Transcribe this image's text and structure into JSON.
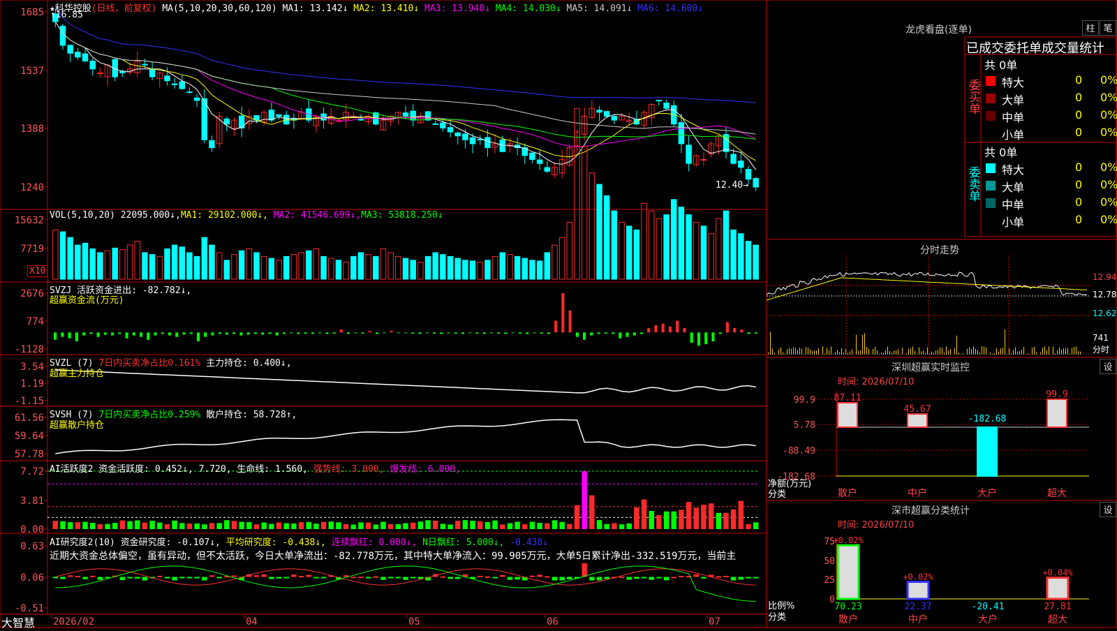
{
  "app": {
    "brand": "大智慧"
  },
  "main_chart": {
    "title_star": "★",
    "stock_name": "科华控股",
    "mode": "(日线，前复权)",
    "ma_params": "MA(5,10,20,30,60,120)",
    "ma_values": [
      {
        "label": "MA1: 13.142↓",
        "color": "#ffffff"
      },
      {
        "label": "MA2: 13.410↓",
        "color": "#ffff00"
      },
      {
        "label": "MA3: 13.940↓",
        "color": "#ff00ff"
      },
      {
        "label": "MA4: 14.030↓",
        "color": "#00ff00"
      },
      {
        "label": "MA5: 14.091↓",
        "color": "#cccccc"
      },
      {
        "label": "MA6: 14.600↓",
        "color": "#3333ff"
      }
    ],
    "high_label": "16.85",
    "low_label": "12.40",
    "y_ticks": [
      "1685",
      "1537",
      "1388",
      "1240"
    ]
  },
  "vol_panel": {
    "label": "VOL(5,10,20)",
    "value": "22095.000↓,",
    "ma1": "MA1: 29102.000↓,",
    "ma2": "MA2: 41546.699↓,",
    "ma3": "MA3: 53818.250↓",
    "y_ticks": [
      "15632",
      "7719"
    ],
    "multiplier": "X10"
  },
  "svzj_panel": {
    "label": "SVZJ  活跃资金进出: -82.782↓,",
    "sub": "超赢资金流(万元)",
    "y_ticks": [
      "2676",
      "774",
      "-1128"
    ]
  },
  "svzl_panel": {
    "label": "SVZL (7)",
    "label2": "7日内买卖净占比0.161%",
    "label3": "主力持仓: 0.400↓,",
    "sub": "超赢主力持仓",
    "y_ticks": [
      "3.54",
      "1.19",
      "-1.15"
    ]
  },
  "svsh_panel": {
    "label": "SVSH (7)",
    "label2": "7日内买卖净占比0.259%",
    "label3": "散户持仓: 58.728↑,",
    "sub": "超赢散户持仓",
    "y_ticks": [
      "61.56",
      "59.64",
      "57.78"
    ]
  },
  "ai_active_panel": {
    "label": "AI活跃度2 资金活跃度: 0.452↓, 7.720, 生命线: 1.560,",
    "label2": "强势线: 3.000,",
    "label3": "爆发线: 6.000,",
    "y_ticks": [
      "7.72",
      "3.81",
      "0.00"
    ]
  },
  "ai_research_panel": {
    "label": "AI研究度2(10) 资金研究度: -0.107↓,",
    "label2": "平均研究度: -0.438↓,",
    "label3": "连续飘红: 0.000↓,",
    "label4": "N日飘红: 5.000↓,",
    "label5": "-0.438↓",
    "commentary": "近期大资金总体偏空，虽有异动，但不太活跃，今日大单净流出：-82.778万元，其中特大单净流入：99.905万元，大单5日累计净出-332.519万元，当前主",
    "y_ticks": [
      "0.63",
      "0.06",
      "-0.51"
    ]
  },
  "x_axis": [
    "2026/02",
    "04",
    "05",
    "06",
    "07"
  ],
  "right": {
    "lhb_title": "龙虎看盘(逐单)",
    "btn_zhu": "柱",
    "btn_bi": "笔",
    "order_header": "已成交委托单成交量统计",
    "buy_side": {
      "side_label": "委买单",
      "total": "共 0单",
      "rows": [
        {
          "name": "特大",
          "count": "0",
          "pct": "0%",
          "color": "#ff0000"
        },
        {
          "name": "大单",
          "count": "0",
          "pct": "0%",
          "color": "#990000"
        },
        {
          "name": "中单",
          "count": "0",
          "pct": "0%",
          "color": "#660000"
        },
        {
          "name": "小单",
          "count": "0",
          "pct": "0%",
          "color": "#000000"
        }
      ]
    },
    "sell_side": {
      "side_label": "委卖单",
      "total": "共 0单",
      "rows": [
        {
          "name": "特大",
          "count": "0",
          "pct": "0%",
          "color": "#00ffff"
        },
        {
          "name": "大单",
          "count": "0",
          "pct": "0%",
          "color": "#009999"
        },
        {
          "name": "中单",
          "count": "0",
          "pct": "0%",
          "color": "#006666"
        },
        {
          "name": "小单",
          "count": "0",
          "pct": "0%",
          "color": "#000000"
        }
      ]
    },
    "intraday": {
      "title": "分时走势",
      "y_ticks": [
        "12.94",
        "12.78",
        "12.62"
      ],
      "vol_tick": "741",
      "vol_label": "分时"
    },
    "sz_monitor": {
      "title": "深圳超赢实时监控",
      "settings": "设",
      "time": "时间: 2026/07/10",
      "y_ticks": [
        "99.9",
        "5.78",
        "-88.49",
        "-182.68"
      ],
      "axis_label1": "净额(万元)",
      "axis_label2": "分类",
      "categories": [
        "散户",
        "中户",
        "大户",
        "超大"
      ],
      "values": [
        "87.11",
        "45.67",
        "-182.68",
        "99.9"
      ]
    },
    "sz_class": {
      "title": "深市超赢分类统计",
      "settings": "设",
      "time": "时间: 2026/07/10",
      "y_ticks": [
        "75",
        "50",
        "25",
        "0"
      ],
      "axis_label1": "比例%",
      "axis_label2": "分类",
      "categories": [
        "散户",
        "中户",
        "大户",
        "超大"
      ],
      "top_labels": [
        "+0.02%",
        "+0.02%",
        "",
        "+0.04%"
      ],
      "values": [
        "70.23",
        "22.37",
        "-20.41",
        "27.81"
      ]
    }
  },
  "chart_data": [
    {
      "type": "candlestick",
      "title": "科华控股 (日线，前复权)",
      "ylim": [
        12.4,
        16.85
      ],
      "x_range": [
        "2026/02",
        "2026/07/10"
      ],
      "ohlc_trend_close": [
        16.6,
        16.0,
        15.8,
        15.7,
        15.6,
        15.4,
        15.3,
        15.5,
        15.2,
        15.3,
        15.4,
        15.6,
        15.5,
        15.2,
        15.3,
        15.1,
        15.0,
        14.9,
        14.8,
        14.6,
        13.6,
        13.4,
        14.2,
        14.0,
        14.1,
        13.9,
        14.2,
        14.1,
        14.3,
        14.1,
        14.2,
        14.0,
        14.1,
        14.3,
        14.1,
        14.2,
        14.1,
        14.2,
        14.1,
        14.3,
        14.2,
        14.1,
        14.2,
        14.0,
        14.1,
        14.2,
        14.3,
        14.2,
        14.1,
        14.2,
        14.1,
        14.0,
        13.9,
        13.8,
        13.7,
        13.6,
        13.5,
        13.6,
        13.4,
        13.5,
        13.3,
        13.5,
        13.4,
        13.2,
        13.1,
        13.0,
        12.8,
        12.9,
        13.1,
        13.4,
        13.8,
        14.2,
        14.4,
        14.3,
        14.2,
        14.1,
        14.2,
        14.1,
        14.0,
        14.3,
        14.5,
        14.6,
        14.4,
        14.0,
        13.5,
        13.0,
        13.2,
        13.1,
        13.5,
        13.7,
        13.3,
        13.0,
        12.9,
        12.6,
        12.4
      ],
      "ma": [
        {
          "name": "MA1",
          "last": 13.142
        },
        {
          "name": "MA2",
          "last": 13.41
        },
        {
          "name": "MA3",
          "last": 13.94
        },
        {
          "name": "MA4",
          "last": 14.03
        },
        {
          "name": "MA5",
          "last": 14.091
        },
        {
          "name": "MA6",
          "last": 14.6
        }
      ]
    },
    {
      "type": "bar",
      "title": "VOL(5,10,20)",
      "ylim": [
        0,
        15632
      ],
      "last_value": 22095.0,
      "values_x10": [
        1300,
        1250,
        1100,
        900,
        950,
        800,
        700,
        750,
        820,
        780,
        900,
        1000,
        700,
        650,
        600,
        800,
        900,
        850,
        700,
        600,
        1100,
        900,
        700,
        500,
        650,
        750,
        800,
        700,
        600,
        550,
        500,
        600,
        650,
        700,
        750,
        800,
        600,
        550,
        500,
        450,
        600,
        700,
        650,
        600,
        800,
        700,
        600,
        550,
        500,
        450,
        600,
        700,
        650,
        600,
        550,
        500,
        480,
        450,
        500,
        600,
        700,
        650,
        600,
        550,
        500,
        480,
        700,
        900,
        1100,
        1500,
        4500,
        3500,
        2800,
        2500,
        2200,
        1800,
        1500,
        1400,
        1300,
        2000,
        1800,
        1600,
        1700,
        2100,
        1900,
        1700,
        1500,
        1400,
        1200,
        1600,
        1800,
        1300,
        1200,
        1000,
        900
      ]
    },
    {
      "type": "bar",
      "title": "SVZJ 活跃资金进出",
      "ylim": [
        -1128,
        2676
      ],
      "values": [
        -500,
        -300,
        -400,
        -600,
        -200,
        -100,
        -300,
        -150,
        -200,
        -100,
        -400,
        -200,
        -300,
        -500,
        -200,
        -100,
        -200,
        -300,
        -150,
        -100,
        -600,
        -300,
        -200,
        -100,
        -150,
        -100,
        -200,
        -150,
        -100,
        -150,
        -100,
        -200,
        -100,
        -50,
        -100,
        -80,
        -100,
        -50,
        -100,
        -80,
        200,
        -100,
        -50,
        -80,
        100,
        -100,
        -50,
        100,
        -50,
        -30,
        -80,
        -100,
        -50,
        -80,
        -100,
        -50,
        -80,
        -100,
        -50,
        -80,
        -100,
        -50,
        -80,
        -100,
        -50,
        -80,
        -100,
        -50,
        -80,
        -100,
        800,
        2676,
        1500,
        -300,
        -500,
        -200,
        -100,
        -80,
        -100,
        -400,
        -300,
        -200,
        -100,
        300,
        500,
        600,
        400,
        800,
        300,
        -700,
        -900,
        -800,
        -600,
        -100,
        700,
        300,
        200,
        -100,
        -82.782
      ]
    },
    {
      "type": "line",
      "title": "SVZL 超赢主力持仓",
      "ylim": [
        -1.15,
        3.54
      ],
      "last_value": 0.4
    },
    {
      "type": "line",
      "title": "SVSH 超赢散户持仓",
      "ylim": [
        57.78,
        61.56
      ],
      "last_value": 58.728
    },
    {
      "type": "bar",
      "title": "AI活跃度2",
      "ylim": [
        0,
        7.72
      ],
      "levels": {
        "生命线": 1.56,
        "强势线": 3.0,
        "爆发线": 6.0
      },
      "last_value": 0.452
    },
    {
      "type": "bar",
      "title": "AI研究度2(10)",
      "ylim": [
        -0.51,
        0.63
      ],
      "last_value": -0.107,
      "avg": -0.438
    },
    {
      "type": "bar",
      "title": "深圳超赢实时监控",
      "categories": [
        "散户",
        "中户",
        "大户",
        "超大"
      ],
      "values": [
        87.11,
        45.67,
        -182.68,
        99.9
      ],
      "ylim": [
        -182.68,
        99.9
      ],
      "ylabel": "净额(万元)",
      "xlabel": "分类"
    },
    {
      "type": "bar",
      "title": "深市超赢分类统计",
      "categories": [
        "散户",
        "中户",
        "大户",
        "超大"
      ],
      "values": [
        70.23,
        22.37,
        -20.41,
        27.81
      ],
      "ylim": [
        0,
        75
      ],
      "ylabel": "比例%",
      "xlabel": "分类"
    }
  ],
  "colors": {
    "up": "#ff2a2a",
    "down": "#00ffff",
    "grid": "#cc0000",
    "axis_text": "#ff5555"
  }
}
